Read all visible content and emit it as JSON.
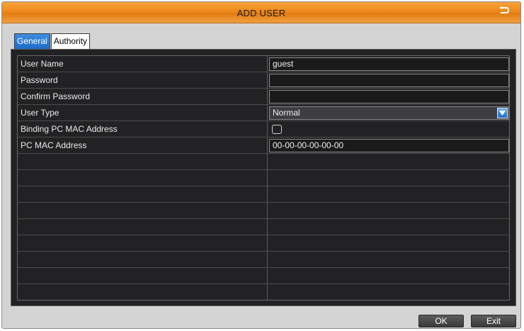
{
  "window": {
    "title": "ADD USER",
    "back_icon": "return-arrow-icon"
  },
  "tabs": [
    {
      "label": "General",
      "active": true
    },
    {
      "label": "Authority",
      "active": false
    }
  ],
  "form": {
    "user_name": {
      "label": "User Name",
      "value": "guest"
    },
    "password": {
      "label": "Password",
      "value": ""
    },
    "confirm_password": {
      "label": "Confirm Password",
      "value": ""
    },
    "user_type": {
      "label": "User Type",
      "value": "Normal"
    },
    "binding_mac": {
      "label": "Binding PC MAC Address",
      "checked": false
    },
    "pc_mac": {
      "label": "PC MAC Address",
      "value": "00-00-00-00-00-00"
    }
  },
  "buttons": {
    "ok": "OK",
    "exit": "Exit"
  },
  "colors": {
    "title_bar": "#ee8a1c",
    "active_tab": "#1d6cc6",
    "panel_bg": "#222224"
  }
}
